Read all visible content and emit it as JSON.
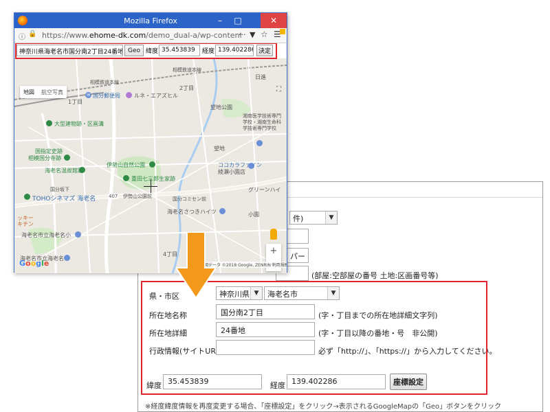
{
  "browser": {
    "title": "Mozilla Firefox",
    "url_prefix": "https://www.",
    "url_domain": "ehome-dk.com",
    "url_rest": "/demo_dual-a/wp-content/plugins/fud",
    "minimize": "–",
    "maximize": "□",
    "close": "✕"
  },
  "searchbar": {
    "address_value": "神奈川県海老名市国分南2丁目24番地",
    "geo_label": "Geo",
    "lat_label": "緯度：",
    "lat_value": "35.453839",
    "lng_label": "経度：",
    "lng_value": "139.402286",
    "decide_label": "決定"
  },
  "map": {
    "type_map": "地図",
    "type_satellite": "航空写真",
    "google": "Google",
    "attribution": "地図データ ©2018 Google, ZENRIN   利用規約",
    "labels": {
      "sagami_railway": "相模鉄道本線",
      "sagami_railway2": "相模鉄道本線",
      "itchome": "1丁目",
      "nichome": "2丁目",
      "kokubunji_post": "国分郵便局",
      "lune": "ルネ・エアズヒル",
      "nozomi_park": "望地公園",
      "daibutsu": "大型建物跡・区画溝",
      "kokushitei": "国指定史跡",
      "sagami_kokubunji": "相模国分寺跡",
      "onsen": "海老名温故館跡",
      "iseyama": "伊勢山自然公園",
      "juuden": "重田七三郎生家跡",
      "cocokara": "ココカラファイン",
      "ayase": "綾瀬小園店",
      "toho": "TOHOシネマズ 海老名",
      "kokubun_crossing": "国分坂下",
      "iseyama_mae": "伊勢山公園前",
      "kokubun_common": "国分コミセン前",
      "green": "グリーンハイ",
      "ebina_tsutsuki": "海老名さつきハイツ",
      "elementary": "海老名市立海老名小",
      "middle": "海老名市立海老名中",
      "yontchome": "4丁目",
      "shonan": "湘南医学技術専門学校・湘南生命科学技術専門学校",
      "mochi": "望地",
      "kosei": "小園",
      "yosu": "日進",
      "route407": "407",
      "mackee": "ッキー\nキチン"
    }
  },
  "form": {
    "partial_select_tail": "件)",
    "partial_input_tail": "パー",
    "room_note": "(部屋:空部屋の番号 土地:区画番号等)",
    "pref_city_label": "県・市区",
    "pref_value": "神奈川県",
    "city_value": "海老名市",
    "address_label": "所在地名称",
    "address_value": "国分南2丁目",
    "address_note": "(字・丁目までの所在地詳細文字列)",
    "detail_label": "所在地詳細",
    "detail_value": "24番地",
    "detail_note": "(字・丁目以降の番地・号　非公開)",
    "admin_label": "行政情報(サイトURL)",
    "admin_value": "",
    "admin_note": "必ず「http://」、「https://」から入力してください。",
    "lat_label": "緯度",
    "lat_value": "35.453839",
    "lng_label": "経度",
    "lng_value": "139.402286",
    "coord_button": "座標設定",
    "footer_note": "※経度緯度情報を再度変更する場合、「座標設定」をクリック→表示されるGoogleMapの「Geo」ボタンをクリック"
  },
  "colors": {
    "highlight": "#e0242b",
    "arrow": "#f39a1d",
    "titlebar": "#2b63c8"
  }
}
